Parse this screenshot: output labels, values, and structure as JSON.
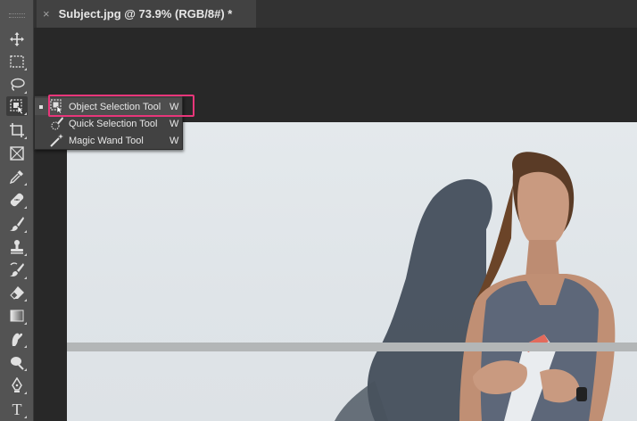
{
  "document_tab": {
    "close_glyph": "×",
    "title": "Subject.jpg @ 73.9% (RGB/8#) *"
  },
  "toolbar": {
    "tools": [
      {
        "name": "move-tool",
        "icon": "move-icon"
      },
      {
        "name": "rectangular-marquee-tool",
        "icon": "marquee-icon"
      },
      {
        "name": "lasso-tool",
        "icon": "lasso-icon"
      },
      {
        "name": "object-selection-tool",
        "icon": "object-selection-icon",
        "active": true
      },
      {
        "name": "crop-tool",
        "icon": "crop-icon"
      },
      {
        "name": "frame-tool",
        "icon": "frame-icon"
      },
      {
        "name": "eyedropper-tool",
        "icon": "eyedropper-icon"
      },
      {
        "name": "healing-brush-tool",
        "icon": "bandage-icon"
      },
      {
        "name": "brush-tool",
        "icon": "brush-icon"
      },
      {
        "name": "clone-stamp-tool",
        "icon": "stamp-icon"
      },
      {
        "name": "history-brush-tool",
        "icon": "history-brush-icon"
      },
      {
        "name": "eraser-tool",
        "icon": "eraser-icon"
      },
      {
        "name": "gradient-tool",
        "icon": "gradient-icon"
      },
      {
        "name": "smudge-tool",
        "icon": "smudge-icon"
      },
      {
        "name": "dodge-tool",
        "icon": "dodge-icon"
      },
      {
        "name": "pen-tool",
        "icon": "pen-icon"
      },
      {
        "name": "type-tool",
        "icon": "type-icon",
        "glyph": "T"
      }
    ]
  },
  "flyout": {
    "items": [
      {
        "label": "Object Selection Tool",
        "shortcut": "W",
        "selected": true
      },
      {
        "label": "Quick Selection Tool",
        "shortcut": "W",
        "selected": false
      },
      {
        "label": "Magic Wand Tool",
        "shortcut": "W",
        "selected": false
      }
    ]
  },
  "colors": {
    "highlight": "#e8367a",
    "panel": "#535353",
    "menu": "#424242"
  }
}
